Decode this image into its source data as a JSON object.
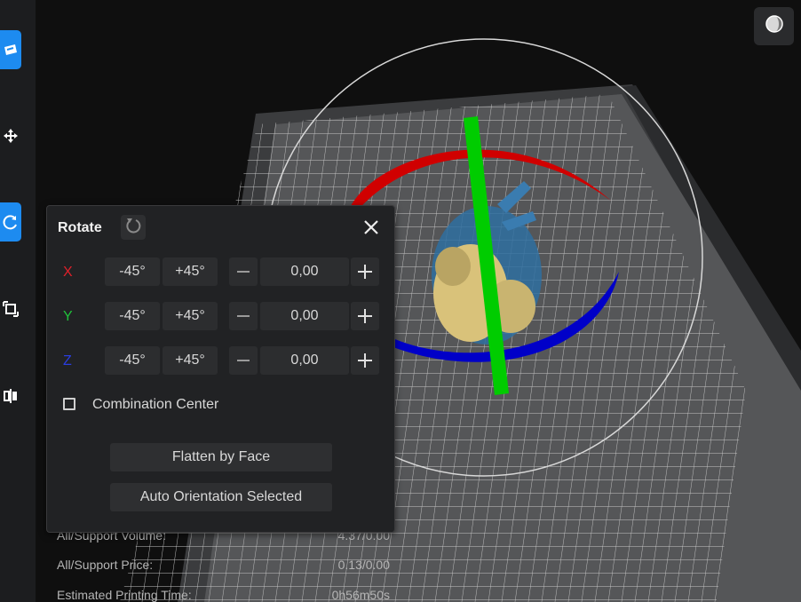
{
  "colors": {
    "accent": "#1d8bf0",
    "axis_x": "#e0202a",
    "axis_y": "#1fc23a",
    "axis_z": "#2a3ee0",
    "gizmo_red": "#d40000",
    "gizmo_green": "#00d000",
    "gizmo_blue": "#0000c8"
  },
  "toolbar": {
    "icons": [
      "slice-icon",
      "move-icon",
      "rotate-icon",
      "scale-icon",
      "mirror-icon"
    ],
    "active": "rotate-icon"
  },
  "view_button": {
    "icon": "view-sphere-icon"
  },
  "rotate_panel": {
    "title": "Rotate",
    "reset_icon": "reset-icon",
    "close_icon": "close-icon",
    "axes": [
      {
        "label": "X",
        "minus_label": "-45°",
        "plus_label": "+45°",
        "value": "0,00"
      },
      {
        "label": "Y",
        "minus_label": "-45°",
        "plus_label": "+45°",
        "value": "0,00"
      },
      {
        "label": "Z",
        "minus_label": "-45°",
        "plus_label": "+45°",
        "value": "0,00"
      }
    ],
    "combination_center": {
      "label": "Combination Center",
      "checked": false
    },
    "flatten_button": "Flatten by Face",
    "auto_orientation_button": "Auto Orientation Selected"
  },
  "info": {
    "volume_label": "All/Support Volume:",
    "volume_value": "4.37/0.00",
    "price_label": "All/Support Price:",
    "price_value": "0.13/0.00",
    "time_label": "Estimated Printing Time:",
    "time_value": "0h56m50s"
  }
}
